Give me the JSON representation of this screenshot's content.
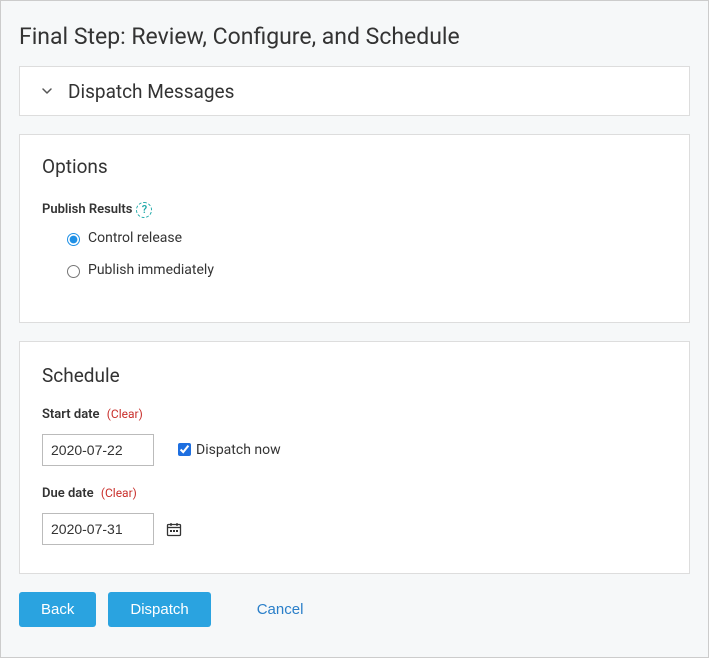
{
  "page_title": "Final Step: Review, Configure, and Schedule",
  "dispatch_messages": {
    "title": "Dispatch Messages"
  },
  "options": {
    "heading": "Options",
    "publish_results_label": "Publish Results",
    "help_symbol": "?",
    "radio": {
      "control_release": "Control release",
      "publish_immediately": "Publish immediately"
    }
  },
  "schedule": {
    "heading": "Schedule",
    "start_date_label": "Start date",
    "start_date_clear": "(Clear)",
    "start_date_value": "2020-07-22",
    "dispatch_now_label": "Dispatch now",
    "due_date_label": "Due date",
    "due_date_clear": "(Clear)",
    "due_date_value": "2020-07-31"
  },
  "buttons": {
    "back": "Back",
    "dispatch": "Dispatch",
    "cancel": "Cancel"
  }
}
